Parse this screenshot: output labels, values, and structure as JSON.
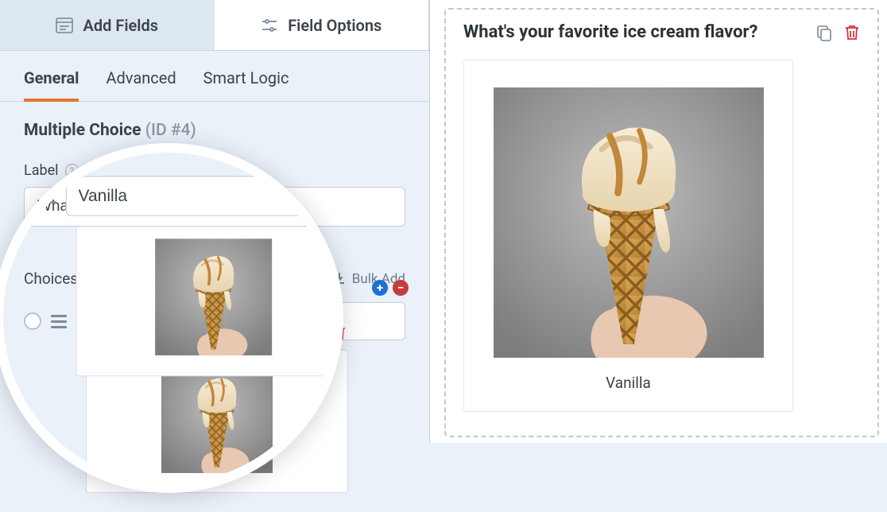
{
  "topTabs": {
    "addFields": "Add Fields",
    "fieldOptions": "Field Options"
  },
  "subTabs": {
    "general": "General",
    "advanced": "Advanced",
    "smartLogic": "Smart Logic"
  },
  "field": {
    "type": "Multiple Choice",
    "idMeta": "(ID #4)",
    "labelLabel": "Label",
    "labelValue": "What's your favorite ice cream flavor?",
    "choicesLabel": "Choices",
    "bulkAdd": "Bulk Add",
    "choice1": "Vanilla"
  },
  "preview": {
    "question": "What's your favorite ice cream flavor?",
    "option1": "Vanilla"
  }
}
